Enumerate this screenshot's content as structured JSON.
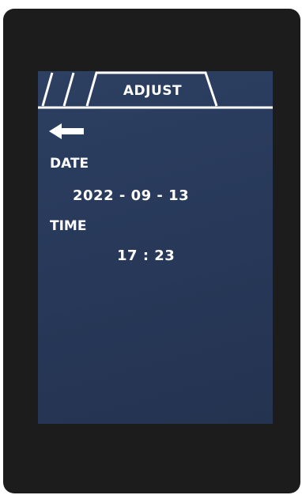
{
  "header": {
    "title": "ADJUST"
  },
  "icons": {
    "back": "arrow-left-icon"
  },
  "date": {
    "label": "DATE",
    "value": "2022 - 09 - 13"
  },
  "time": {
    "label": "TIME",
    "value": "17 : 23"
  },
  "colors": {
    "bezel": "#1c1c1c",
    "screen": "#2b3d5e",
    "text": "#ffffff"
  }
}
